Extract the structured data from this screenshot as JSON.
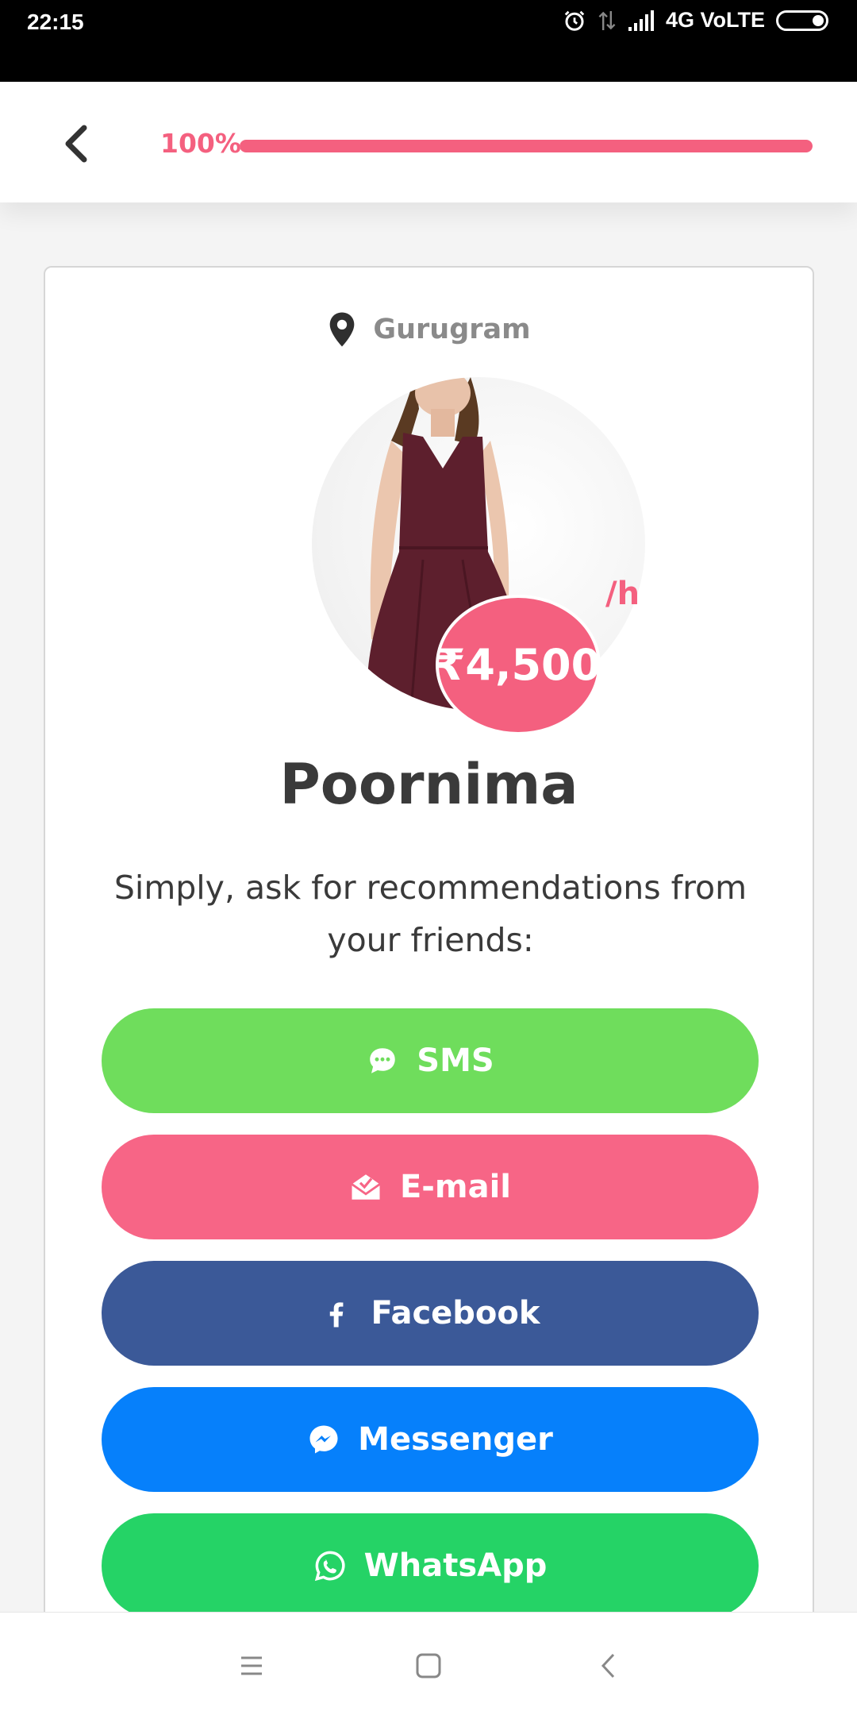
{
  "status_bar": {
    "time": "22:15",
    "network": "4G VoLTE"
  },
  "header": {
    "progress_text": "100%",
    "progress_fraction": 1.0,
    "accent_color": "#f4607f"
  },
  "profile": {
    "location": "Gurugram",
    "price": "₹4,500",
    "price_unit": "/h",
    "name": "Poornima",
    "prompt": "Simply, ask for recommendations from your friends:"
  },
  "share_buttons": [
    {
      "label": "SMS",
      "icon": "sms-chat-icon",
      "color": "#6fdd5c"
    },
    {
      "label": "E-mail",
      "icon": "open-envelope-icon",
      "color": "#f76586"
    },
    {
      "label": "Facebook",
      "icon": "facebook-icon",
      "color": "#3b5998"
    },
    {
      "label": "Messenger",
      "icon": "messenger-icon",
      "color": "#0680fb"
    },
    {
      "label": "WhatsApp",
      "icon": "whatsapp-icon",
      "color": "#25d366"
    }
  ],
  "nav_bar": {
    "icons": [
      "menu-icon",
      "home-square-icon",
      "back-chevron-icon"
    ]
  }
}
